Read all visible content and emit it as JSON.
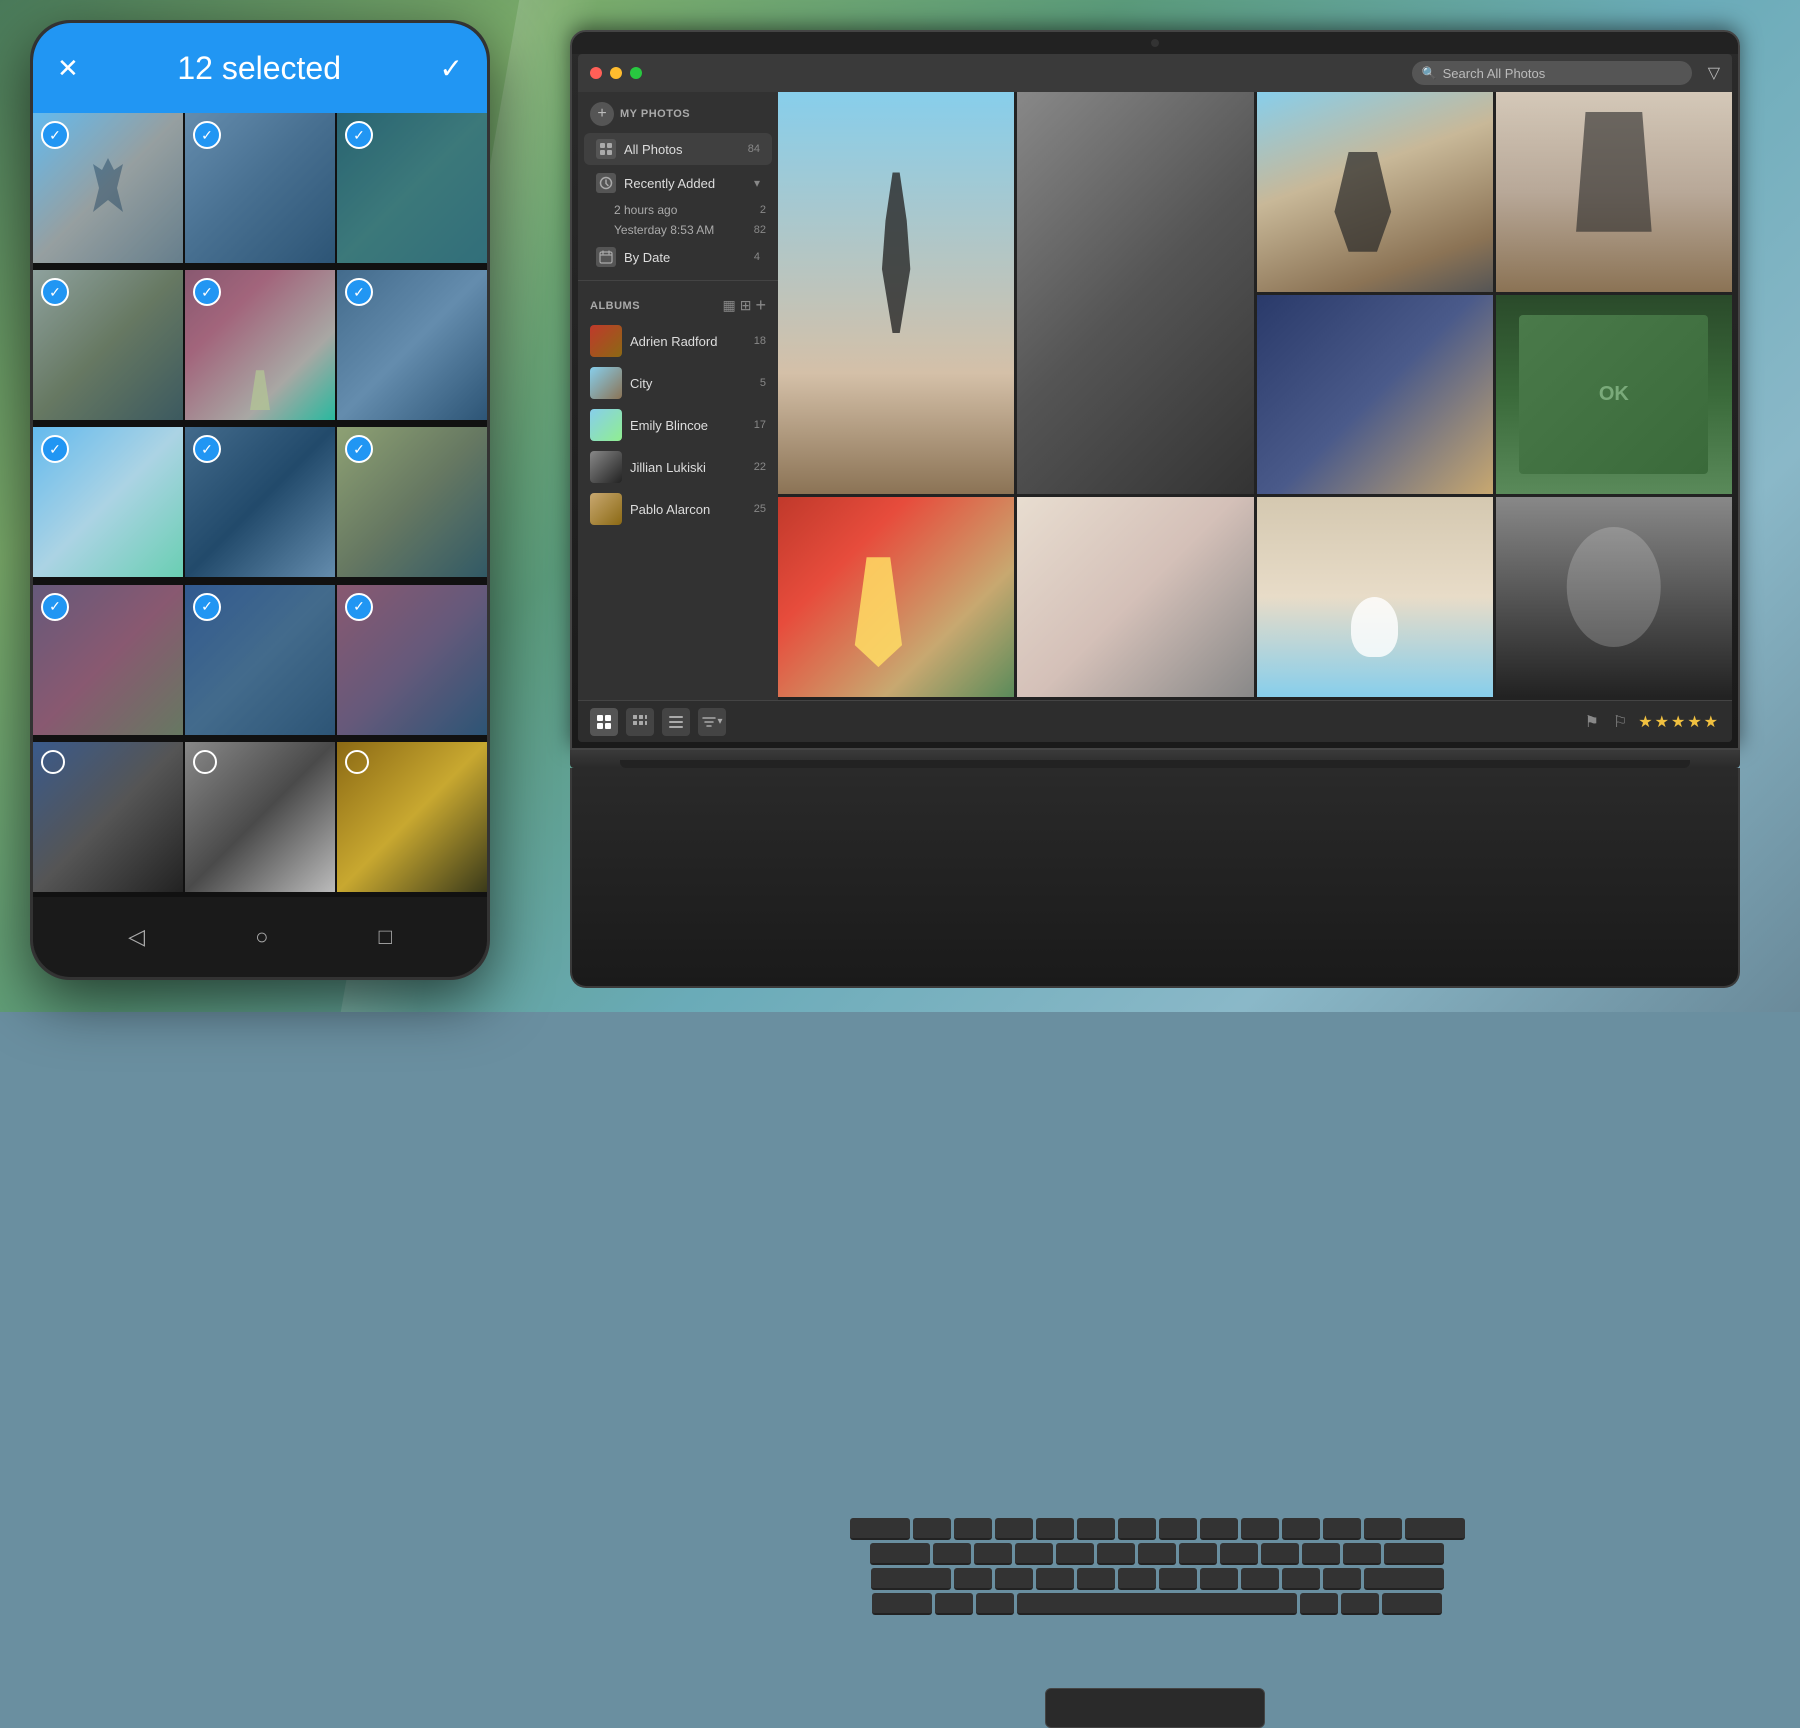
{
  "background": {
    "gradient": "blurred outdoor bokeh"
  },
  "phone": {
    "header": {
      "selected_count": "12 selected",
      "close_label": "✕",
      "check_label": "✓"
    },
    "photos": [
      {
        "id": 1,
        "color_class": "p1",
        "selected": true
      },
      {
        "id": 2,
        "color_class": "p2",
        "selected": true
      },
      {
        "id": 3,
        "color_class": "p3",
        "selected": true
      },
      {
        "id": 4,
        "color_class": "p4",
        "selected": true
      },
      {
        "id": 5,
        "color_class": "p5",
        "selected": true
      },
      {
        "id": 6,
        "color_class": "p6",
        "selected": true
      },
      {
        "id": 7,
        "color_class": "p7",
        "selected": true
      },
      {
        "id": 8,
        "color_class": "p8",
        "selected": true
      },
      {
        "id": 9,
        "color_class": "p9",
        "selected": true
      },
      {
        "id": 10,
        "color_class": "p10",
        "selected": true
      },
      {
        "id": 11,
        "color_class": "p11",
        "selected": true
      },
      {
        "id": 12,
        "color_class": "p12",
        "selected": true
      },
      {
        "id": 13,
        "color_class": "p13",
        "selected": false
      },
      {
        "id": 14,
        "color_class": "p14",
        "selected": false
      },
      {
        "id": 15,
        "color_class": "p15",
        "selected": false
      }
    ],
    "nav": {
      "back_icon": "◁",
      "home_icon": "○",
      "recents_icon": "□"
    }
  },
  "laptop": {
    "titlebar": {
      "traffic_lights": [
        "red",
        "yellow",
        "green"
      ],
      "search_placeholder": "Search All Photos",
      "filter_icon": "▽"
    },
    "sidebar": {
      "my_photos_label": "MY PHOTOS",
      "add_icon": "+",
      "items": [
        {
          "label": "All Photos",
          "count": "84",
          "icon": "🖼",
          "active": true
        }
      ],
      "recently_added": {
        "label": "Recently Added",
        "toggle": "▾",
        "sub_items": [
          {
            "label": "2 hours ago",
            "count": "2"
          },
          {
            "label": "Yesterday 8:53 AM",
            "count": "82"
          }
        ]
      },
      "by_date": {
        "label": "By Date",
        "count": "4"
      },
      "albums_label": "ALBUMS",
      "albums_view1": "▦",
      "albums_view2": "⊞",
      "albums_add": "+",
      "albums": [
        {
          "name": "Adrien Radford",
          "count": "18",
          "color": "at1"
        },
        {
          "name": "City",
          "count": "5",
          "color": "at2"
        },
        {
          "name": "Emily Blincoe",
          "count": "17",
          "color": "at3"
        },
        {
          "name": "Jillian Lukiski",
          "count": "22",
          "color": "at4"
        },
        {
          "name": "Pablo Alarcon",
          "count": "25",
          "color": "at5"
        }
      ]
    },
    "grid": {
      "photos": [
        {
          "id": 1,
          "color_class": "gp1",
          "row": 1,
          "col": 1
        },
        {
          "id": 2,
          "color_class": "gp2",
          "row": 1,
          "col": 2
        },
        {
          "id": 3,
          "color_class": "gp3",
          "row": 1,
          "col": 3
        },
        {
          "id": 4,
          "color_class": "gp4",
          "row": 2,
          "col": 1
        },
        {
          "id": 5,
          "color_class": "gp5",
          "row": 2,
          "col": 2
        },
        {
          "id": 6,
          "color_class": "gp6",
          "row": 2,
          "col": 3
        },
        {
          "id": 7,
          "color_class": "gp7",
          "row": 3,
          "col": 1
        },
        {
          "id": 8,
          "color_class": "gp8",
          "row": 3,
          "col": 2
        },
        {
          "id": 9,
          "color_class": "gp9",
          "row": 3,
          "col": 3
        }
      ]
    },
    "toolbar": {
      "view_buttons": [
        "⊞",
        "⊟",
        "☰"
      ],
      "sort_label": "↕",
      "flag_icon": "⚑",
      "flag2_icon": "⚐",
      "stars": "★★★★★"
    }
  }
}
